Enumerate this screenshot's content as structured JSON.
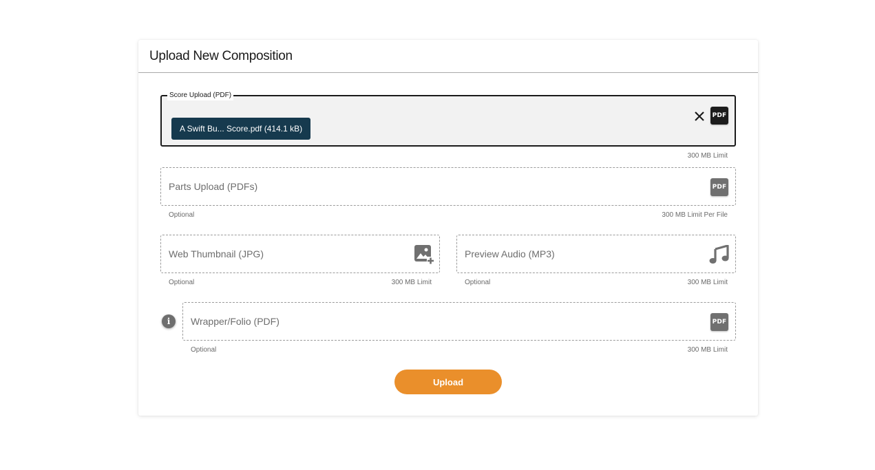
{
  "dialog": {
    "title": "Upload New Composition"
  },
  "score_upload": {
    "legend": "Score Upload (PDF)",
    "file_chip": "A Swift Bu... Score.pdf (414.1 kB)",
    "icon": "pdf-icon",
    "icon_text": "PDF",
    "clear_icon": "close-icon",
    "limit": "300 MB Limit"
  },
  "parts_upload": {
    "label": "Parts Upload (PDFs)",
    "icon": "pdf-icon",
    "icon_text": "PDF",
    "note": "Optional",
    "limit": "300 MB Limit Per File"
  },
  "web_thumbnail": {
    "label": "Web Thumbnail (JPG)",
    "icon": "add-image-icon",
    "note": "Optional",
    "limit": "300 MB Limit"
  },
  "preview_audio": {
    "label": "Preview Audio (MP3)",
    "icon": "music-note-icon",
    "note": "Optional",
    "limit": "300 MB Limit"
  },
  "wrapper_folio": {
    "info_icon": "info-icon",
    "info_text": "i",
    "label": "Wrapper/Folio (PDF)",
    "icon": "pdf-icon",
    "icon_text": "PDF",
    "note": "Optional",
    "limit": "300 MB Limit"
  },
  "upload_button": {
    "label": "Upload"
  },
  "colors": {
    "accent": "#ea8f2b",
    "chip": "#163a4e",
    "icon_gray": "#707070"
  }
}
